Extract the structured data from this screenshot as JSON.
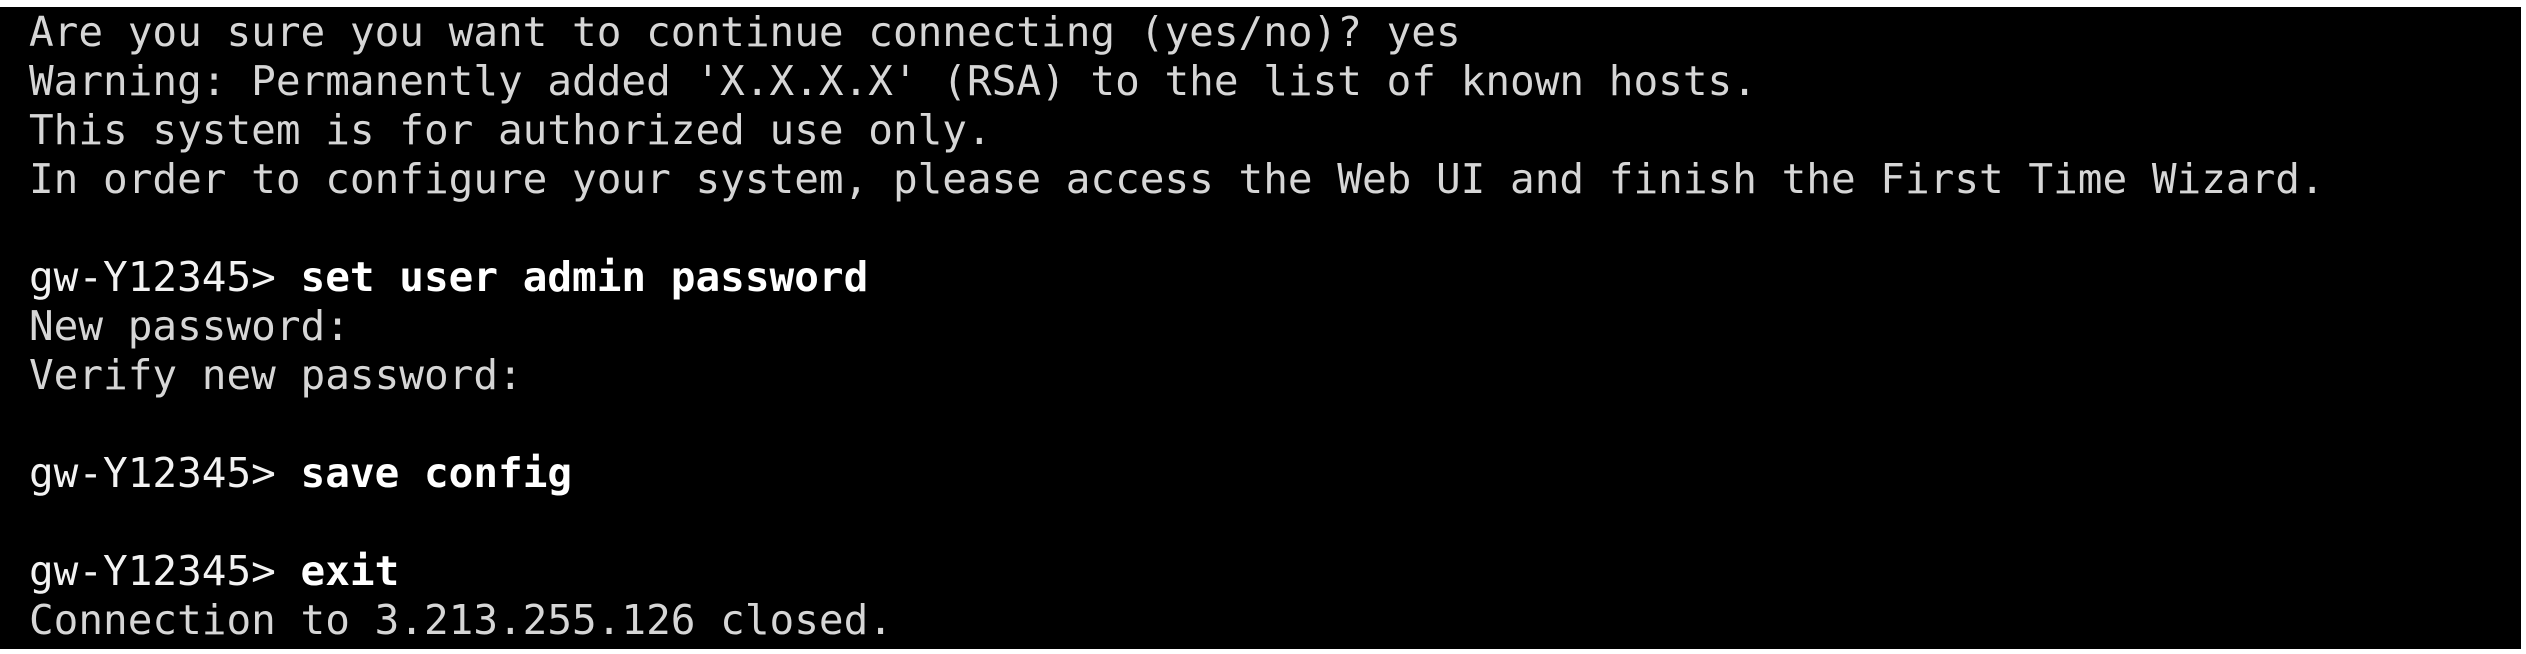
{
  "terminal": {
    "lines": [
      {
        "text": "Are you sure you want to continue connecting (yes/no)? yes"
      },
      {
        "text": "Warning: Permanently added 'X.X.X.X' (RSA) to the list of known hosts."
      },
      {
        "text": "This system is for authorized use only."
      },
      {
        "text": "In order to configure your system, please access the Web UI and finish the First Time Wizard."
      },
      {
        "text": ""
      },
      {
        "prompt": "gw-Y12345> ",
        "command": "set user admin password"
      },
      {
        "text": "New password:"
      },
      {
        "text": "Verify new password:"
      },
      {
        "text": ""
      },
      {
        "prompt": "gw-Y12345> ",
        "command": "save config"
      },
      {
        "text": ""
      },
      {
        "prompt": "gw-Y12345> ",
        "command": "exit"
      },
      {
        "text": "Connection to 3.213.255.126 closed."
      }
    ]
  },
  "colors": {
    "background": "#000000",
    "output_text": "#d6d6d6",
    "command_text": "#ffffff"
  }
}
